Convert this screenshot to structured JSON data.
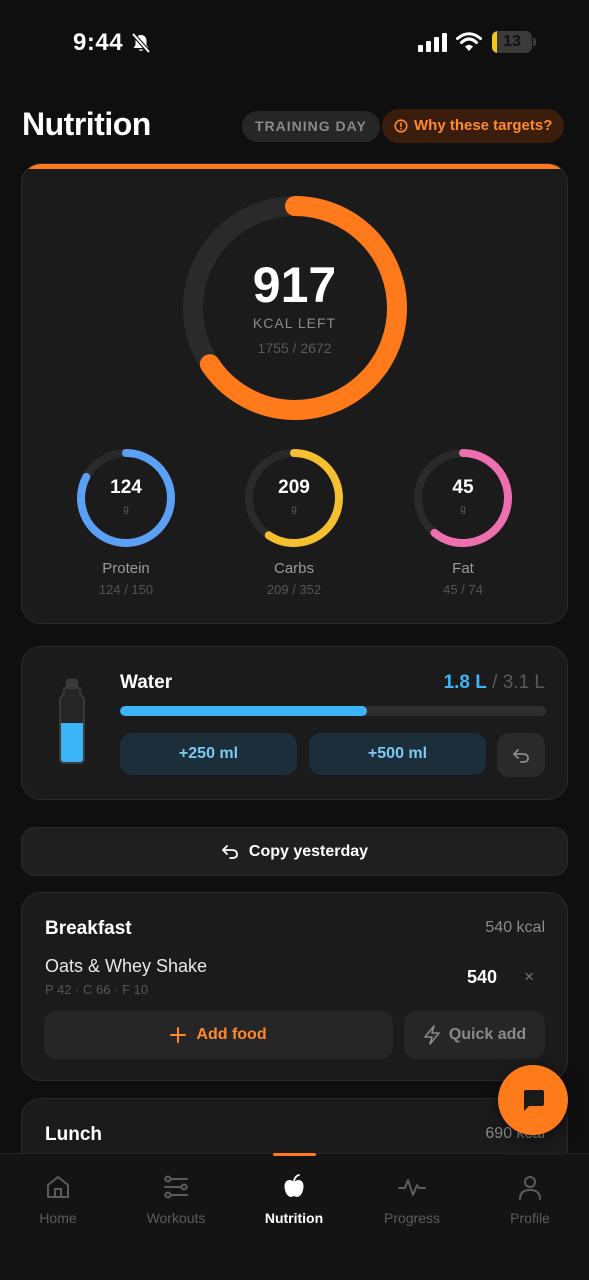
{
  "status_bar": {
    "time": "9:44",
    "battery": "13"
  },
  "header": {
    "title": "Nutrition",
    "day_type": "TRAINING DAY",
    "why_targets": "Why these targets?"
  },
  "calories": {
    "left": "917",
    "left_label": "KCAL LEFT",
    "consumed_of_target": "1755 / 2672",
    "consumed": 1755,
    "target": 2672,
    "color": "#ff7a1a"
  },
  "macros": [
    {
      "name": "Protein",
      "value": "124",
      "unit": "g",
      "sub": "124 / 150",
      "current": 124,
      "target": 150,
      "color": "#5aa0f5"
    },
    {
      "name": "Carbs",
      "value": "209",
      "unit": "g",
      "sub": "209 / 352",
      "current": 209,
      "target": 352,
      "color": "#f5c030"
    },
    {
      "name": "Fat",
      "value": "45",
      "unit": "g",
      "sub": "45 / 74",
      "current": 45,
      "target": 74,
      "color": "#ee6fb0"
    }
  ],
  "water": {
    "title": "Water",
    "current": "1.8 L",
    "separator": " / ",
    "target": "3.1 L",
    "fraction": 0.58,
    "add_250": "+250 ml",
    "add_500": "+500 ml",
    "color": "#3bb5f5"
  },
  "copy_yesterday": "Copy yesterday",
  "meals": [
    {
      "title": "Breakfast",
      "kcal": "540 kcal",
      "food": {
        "name": "Oats & Whey Shake",
        "macros": "P 42 · C 66 · F 10",
        "kcal": "540",
        "remove": "×"
      },
      "add_food": "Add food",
      "quick_add": "Quick add"
    },
    {
      "title": "Lunch",
      "kcal": "690 kcal"
    }
  ],
  "tabs": [
    {
      "label": "Home",
      "icon": "home-icon"
    },
    {
      "label": "Workouts",
      "icon": "workouts-icon"
    },
    {
      "label": "Nutrition",
      "icon": "apple-icon",
      "active": true
    },
    {
      "label": "Progress",
      "icon": "pulse-icon"
    },
    {
      "label": "Profile",
      "icon": "person-icon"
    }
  ],
  "accent_color": "#ff7a1a"
}
